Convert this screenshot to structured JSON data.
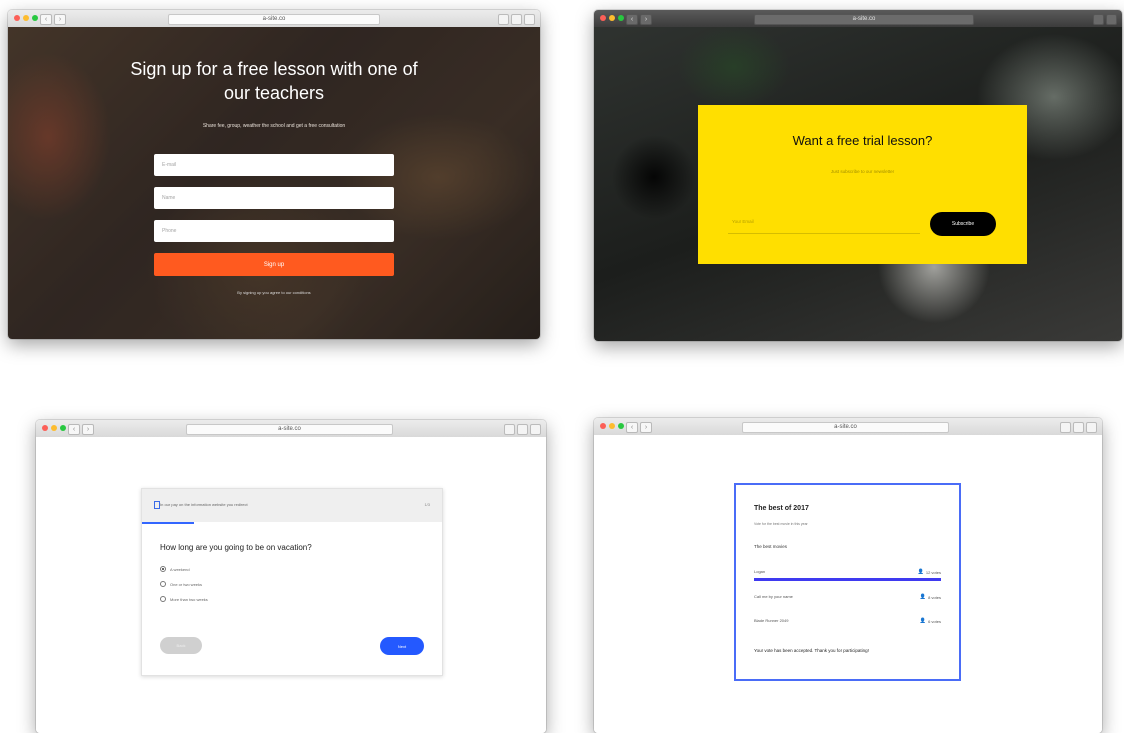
{
  "windows": {
    "signup": {
      "url": "a-site.co",
      "title": "Sign up for a free lesson with one of our teachers",
      "subtitle": "Share fee, group, weather the school and get a free consultation",
      "fields": {
        "email_placeholder": "E-mail",
        "name_placeholder": "Name",
        "phone_placeholder": "Phone"
      },
      "button_label": "Sign up",
      "terms": "By signing up you agree to our conditions"
    },
    "trial": {
      "url": "a-site.co",
      "title": "Want a free trial lesson?",
      "subtitle": "Just subscribe to our newsletter",
      "email_placeholder": "Your Email",
      "button_label": "Subscribe",
      "card_color": "#ffdf00"
    },
    "survey": {
      "url": "a-site.co",
      "info_text": "In our pay on the information website you redirect",
      "count": "1/3",
      "question": "How long are you going to be on vacation?",
      "options": [
        {
          "label": "A weekend",
          "selected": true
        },
        {
          "label": "One or two weeks",
          "selected": false
        },
        {
          "label": "More than two weeks",
          "selected": false
        }
      ],
      "back_label": "Back",
      "next_label": "Next",
      "accent": "#2459ff"
    },
    "poll": {
      "url": "a-site.co",
      "title": "The best of 2017",
      "subtitle": "Vote for the best movie in this year",
      "section": "The best movies",
      "rows": [
        {
          "name": "Logan",
          "votes": "12 votes",
          "leading": true
        },
        {
          "name": "Call me by your name",
          "votes": "8 votes",
          "leading": false
        },
        {
          "name": "Blade Runner 2049",
          "votes": "6 votes",
          "leading": false
        }
      ],
      "confirmation": "Your vote has been accepted. Thank you for participating!",
      "accent": "#4a6cf7"
    }
  }
}
